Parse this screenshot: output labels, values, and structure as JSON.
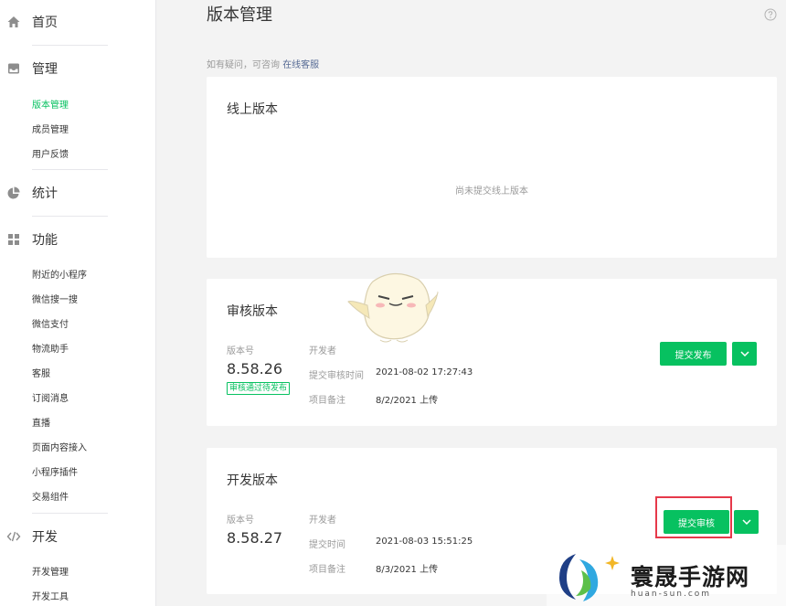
{
  "sidebar": {
    "home": "首页",
    "manage": {
      "label": "管理",
      "items": [
        "版本管理",
        "成员管理",
        "用户反馈"
      ]
    },
    "stats": "统计",
    "features": {
      "label": "功能",
      "items": [
        "附近的小程序",
        "微信搜一搜",
        "微信支付",
        "物流助手",
        "客服",
        "订阅消息",
        "直播",
        "页面内容接入",
        "小程序插件",
        "交易组件"
      ]
    },
    "dev": {
      "label": "开发",
      "items": [
        "开发管理",
        "开发工具"
      ]
    }
  },
  "main": {
    "title": "版本管理",
    "tip_text": "如有疑问，可咨询",
    "tip_link": "在线客服",
    "online": {
      "title": "线上版本",
      "empty": "尚未提交线上版本"
    },
    "review": {
      "title": "审核版本",
      "version_label": "版本号",
      "version": "8.58.26",
      "badge": "审核通过待发布",
      "developer_label": "开发者",
      "submit_time_label": "提交审核时间",
      "submit_time": "2021-08-02 17:27:43",
      "note_label": "项目备注",
      "note": "8/2/2021 上传",
      "button": "提交发布"
    },
    "dev": {
      "title": "开发版本",
      "version_label": "版本号",
      "version": "8.58.27",
      "developer_label": "开发者",
      "submit_time_label": "提交时间",
      "submit_time": "2021-08-03 15:51:25",
      "note_label": "项目备注",
      "note": "8/3/2021 上传",
      "button": "提交审核"
    }
  },
  "watermark": {
    "name": "寰晟手游网",
    "url": "huan-sun.com"
  },
  "colors": {
    "accent": "#07c160",
    "link": "#576b95",
    "highlight": "#e6394a"
  }
}
